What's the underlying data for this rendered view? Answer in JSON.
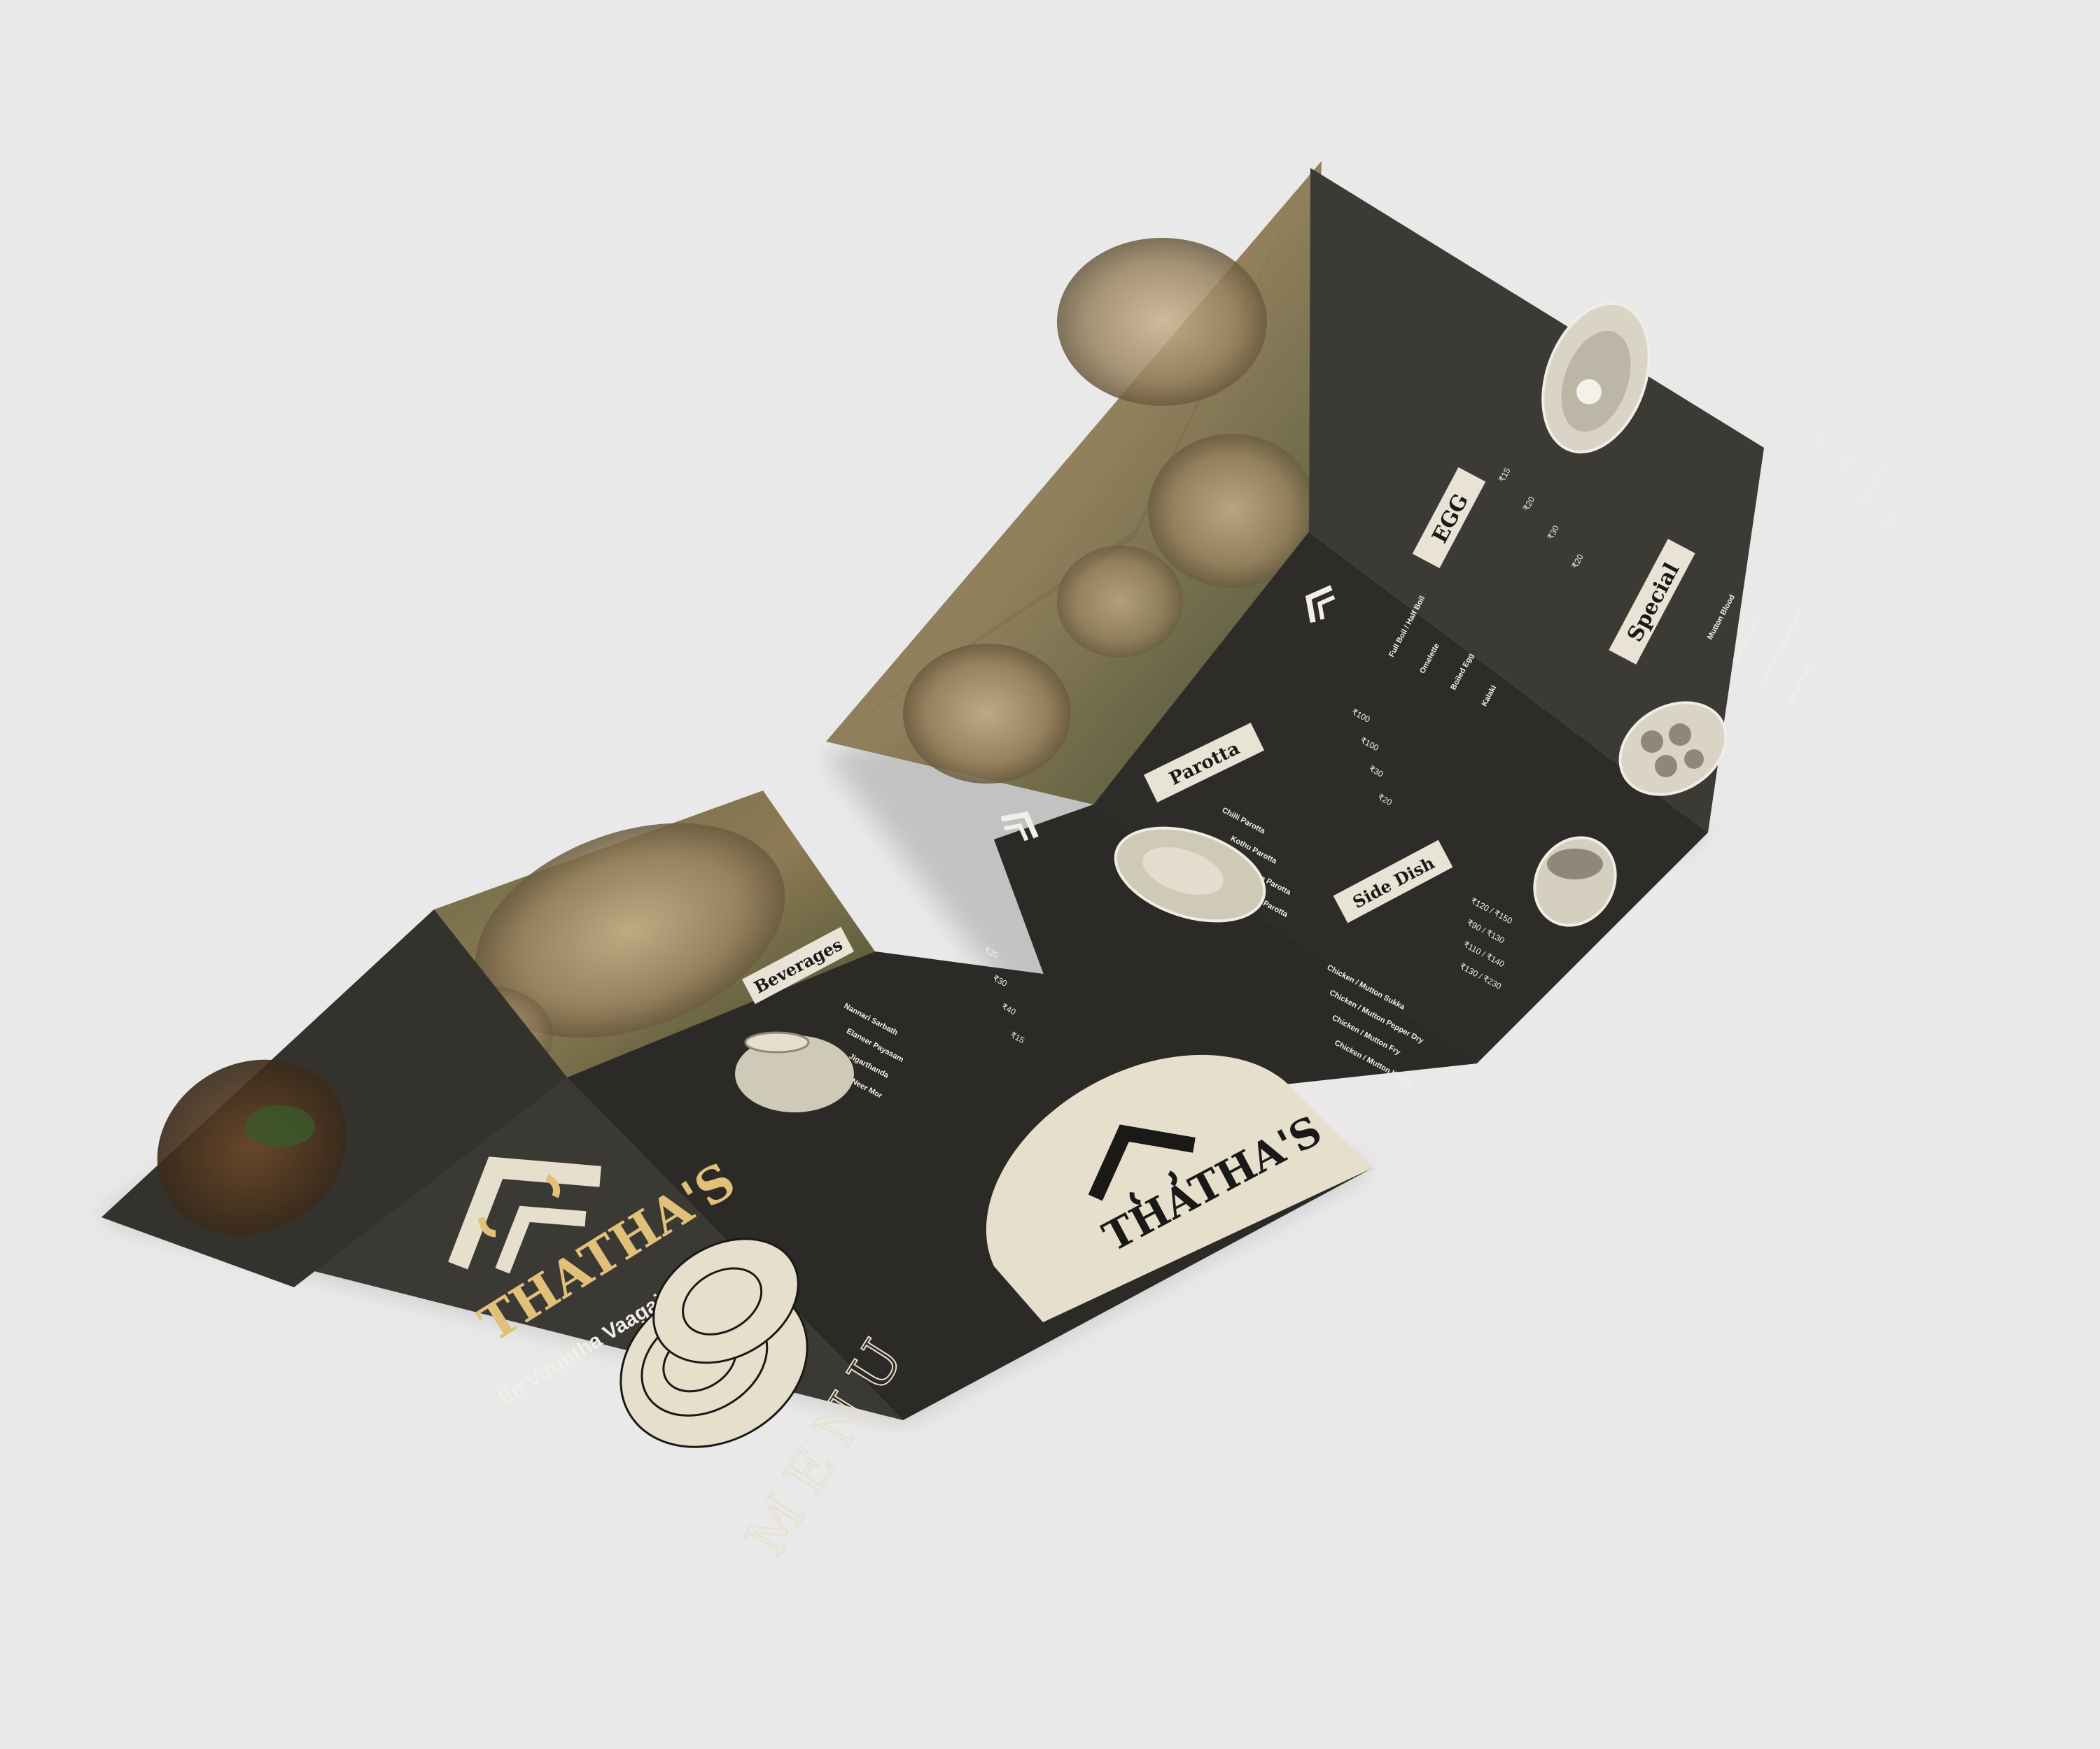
{
  "brand": {
    "name": "THATHA'S",
    "tagline": "En Viruntha Vaagai Soodum",
    "menu_word": "MENU"
  },
  "back_brochure": {
    "beverages": {
      "title": "Beverages",
      "items": [
        "Nannari Sarbath",
        "Elaneer Payasam",
        "Jigarthanda",
        "Neer Mor"
      ],
      "prices": [
        "₹20",
        "₹30",
        "₹40",
        "₹15"
      ]
    }
  },
  "inner_brochure": {
    "egg": {
      "title": "EGG",
      "items": [
        "Full Boil / Half Boil",
        "Omelette",
        "Boiled Egg",
        "Kalaki"
      ],
      "prices": [
        "₹15",
        "₹20",
        "₹30",
        "₹20"
      ]
    },
    "special": {
      "title": "Special",
      "items": [
        "Mutton Blood",
        "Mutton Brain",
        "Chicken / Mutton Liver",
        "Mutton Boti"
      ],
      "prices": [
        "₹80",
        "₹100",
        "₹70 / ₹100",
        "₹130"
      ]
    },
    "parotta": {
      "title": "Parotta",
      "items": [
        "Chilli Parotta",
        "Kothu Parotta",
        "Poricha Parotta",
        "Bun Parotta"
      ],
      "prices": [
        "₹100",
        "₹100",
        "₹30",
        "₹20"
      ]
    },
    "side_dish": {
      "title": "Side Dish",
      "items": [
        "Chicken / Mutton Sukka",
        "Chicken / Mutton Pepper Dry",
        "Chicken / Mutton Fry",
        "Chicken / Mutton Kabab"
      ],
      "prices": [
        "₹120 / ₹150",
        "₹90 / ₹130",
        "₹110 / ₹140",
        "₹130 / ₹230"
      ]
    }
  },
  "colors": {
    "background": "#e9e9e9",
    "panel_dark": "#2b2a26",
    "panel_mid": "#3a3934",
    "cream": "#e6dfcc",
    "gold": "#e1c17a",
    "ink": "#1a1917"
  }
}
